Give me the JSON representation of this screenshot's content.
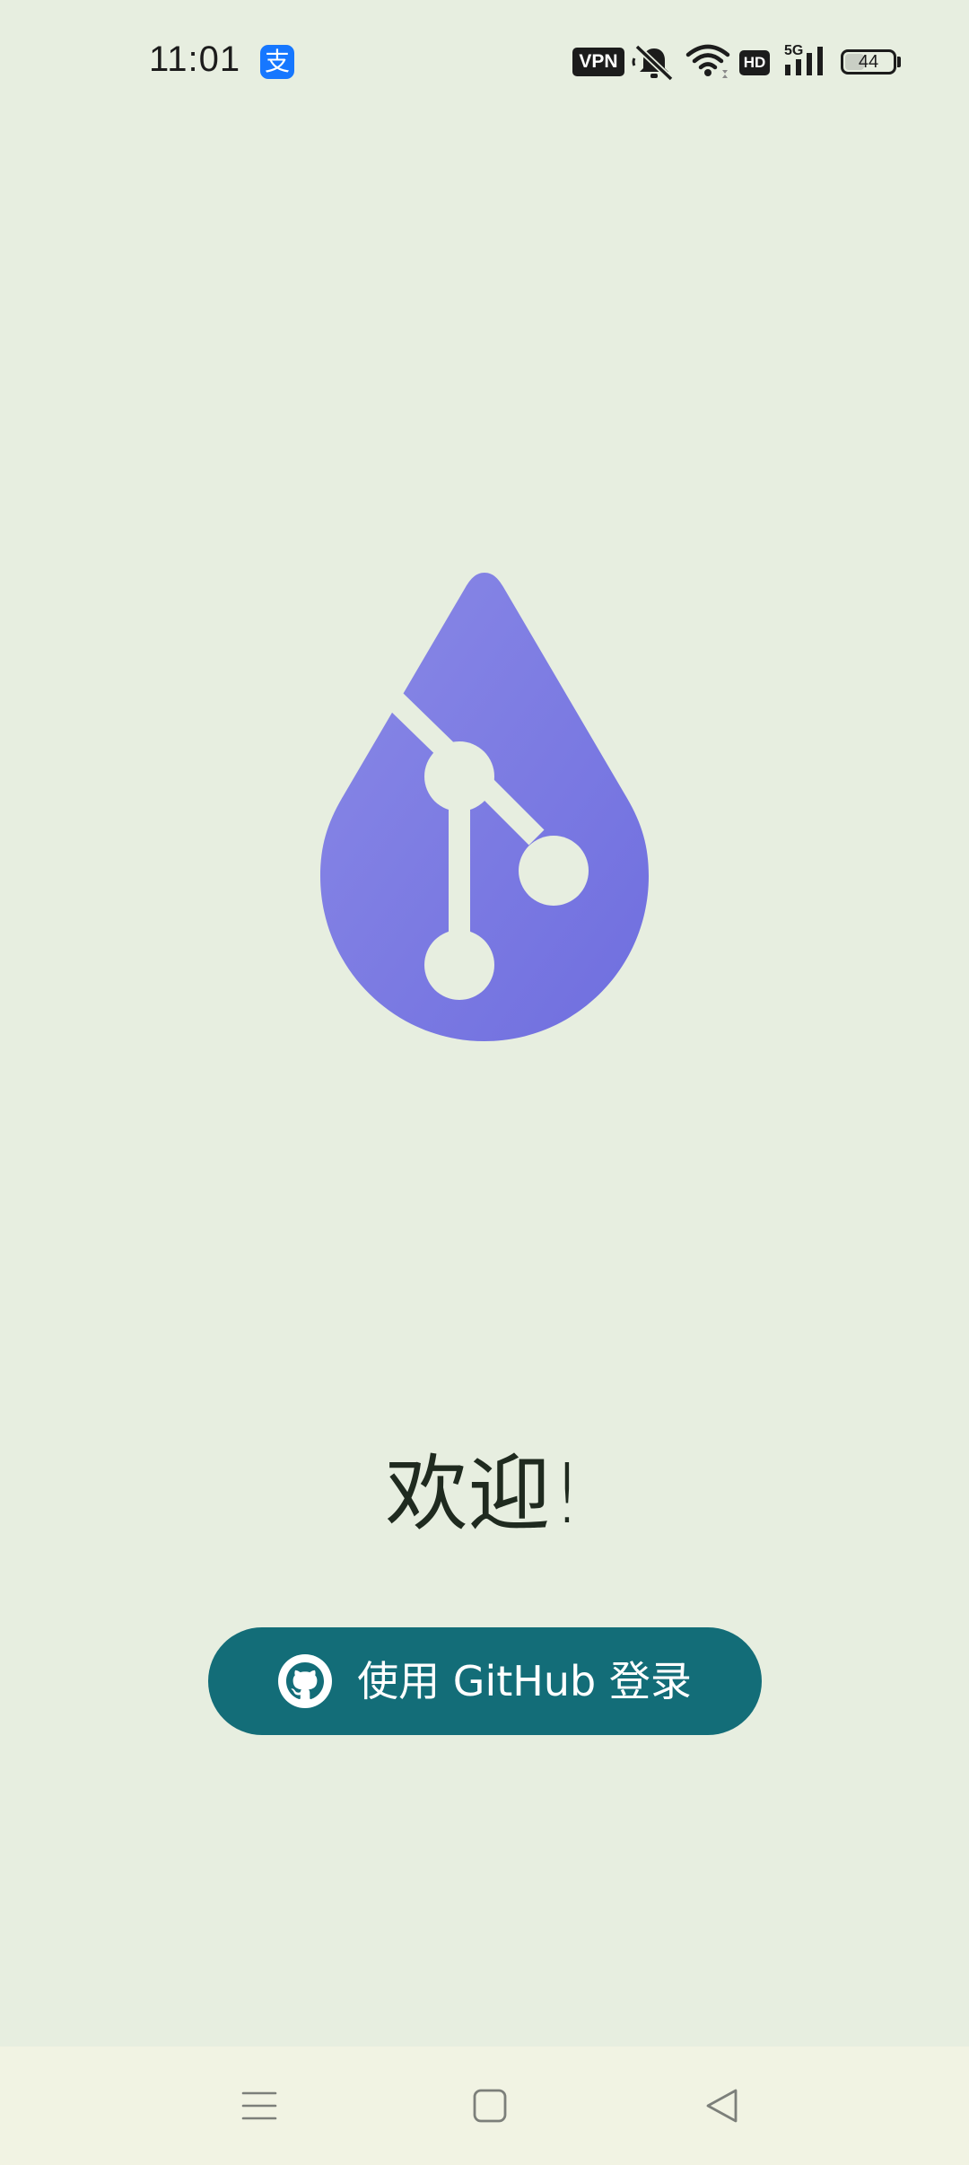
{
  "status_bar": {
    "time": "11:01",
    "alipay_glyph": "支",
    "vpn_label": "VPN",
    "hd_label": "HD",
    "network_type": "5G",
    "battery_level": "44",
    "battery_fraction": 0.44,
    "icons": [
      "alipay-icon",
      "vpn-icon",
      "mute-icon",
      "wifi-icon",
      "hd-icon",
      "signal-icon",
      "battery-icon"
    ]
  },
  "logo": {
    "icon": "git-branch-drop-logo",
    "gradient_top": "#8a89e6",
    "gradient_bottom": "#6f6edf"
  },
  "welcome": {
    "title": "欢迎!"
  },
  "login": {
    "icon": "github-icon",
    "label": "使用 GitHub 登录",
    "button_color": "#136d78"
  },
  "nav_bar": {
    "buttons": [
      "menu-icon",
      "home-icon",
      "back-icon"
    ]
  },
  "colors": {
    "background": "#e7eee0",
    "nav_background": "#f1f3e3"
  }
}
